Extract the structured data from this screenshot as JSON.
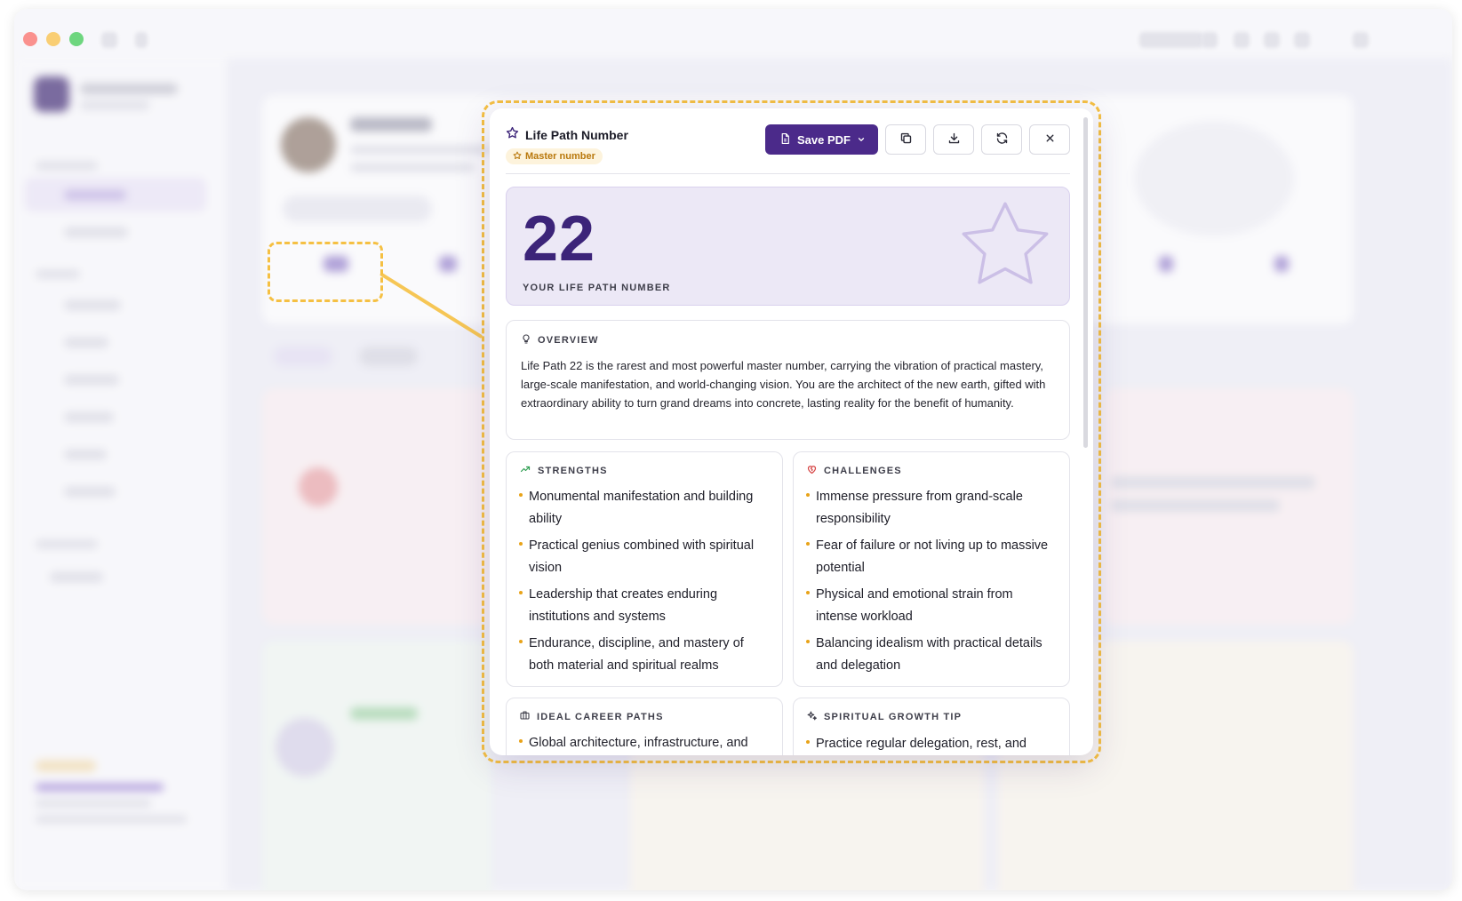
{
  "modal": {
    "title": "Life Path Number",
    "badge": "Master number",
    "save_label": "Save PDF",
    "hero": {
      "number": "22",
      "label": "YOUR LIFE PATH NUMBER"
    },
    "overview": {
      "heading": "OVERVIEW",
      "text": "Life Path 22 is the rarest and most powerful master number, carrying the vibration of practical mastery, large-scale manifestation, and world-changing vision. You are the architect of the new earth, gifted with extraordinary ability to turn grand dreams into concrete, lasting reality for the benefit of humanity."
    },
    "strengths": {
      "heading": "STRENGTHS",
      "items": [
        "Monumental manifestation and building ability",
        "Practical genius combined with spiritual vision",
        "Leadership that creates enduring institutions and systems",
        "Endurance, discipline, and mastery of both material and spiritual realms"
      ]
    },
    "challenges": {
      "heading": "CHALLENGES",
      "items": [
        "Immense pressure from grand-scale responsibility",
        "Fear of failure or not living up to massive potential",
        "Physical and emotional strain from intense workload",
        "Balancing idealism with practical details and delegation"
      ]
    },
    "careers": {
      "heading": "IDEAL CAREER PATHS",
      "items": [
        "Global architecture, infrastructure, and"
      ]
    },
    "growth": {
      "heading": "SPIRITUAL GROWTH TIP",
      "items": [
        "Practice regular delegation, rest, and"
      ]
    }
  },
  "colors": {
    "accent": "#4b2a8a",
    "highlight": "#f5c043",
    "badge_text": "#b9780c",
    "hero_bg": "#ece8f6"
  }
}
